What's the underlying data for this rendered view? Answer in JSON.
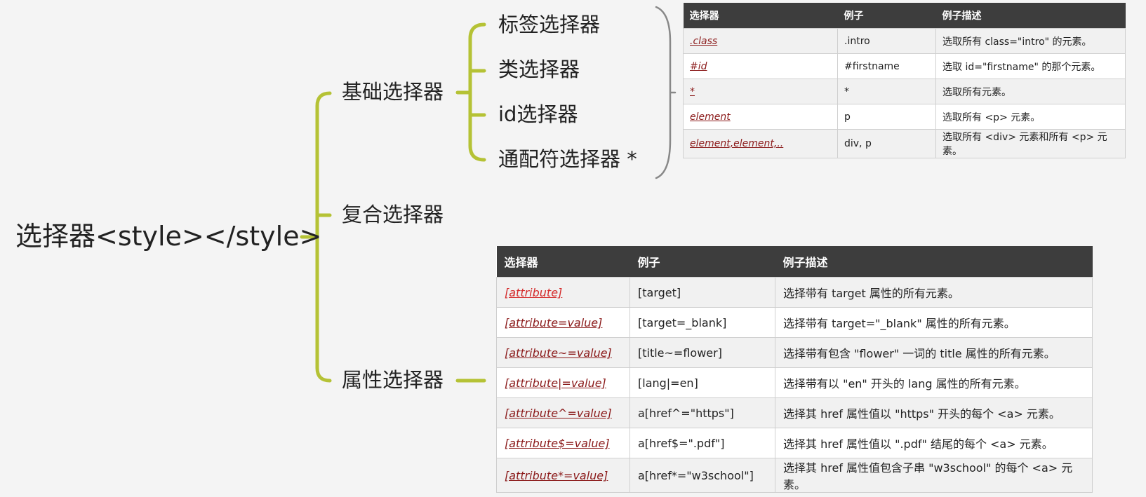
{
  "mindmap": {
    "root": "选择器<style></style>",
    "branches": [
      {
        "label": "基础选择器",
        "children": [
          "标签选择器",
          "类选择器",
          "id选择器",
          "通配符选择器 *"
        ]
      },
      {
        "label": "复合选择器"
      },
      {
        "label": "属性选择器"
      }
    ]
  },
  "colors": {
    "branch_line": "#b5c235",
    "bracket": "#888888",
    "table_header": "#3d3d3d",
    "selector_link": "#8b1a1a"
  },
  "basic_table": {
    "headers": [
      "选择器",
      "例子",
      "例子描述"
    ],
    "rows": [
      [
        ".class",
        ".intro",
        "选取所有 class=\"intro\" 的元素。"
      ],
      [
        "#id",
        "#firstname",
        "选取 id=\"firstname\" 的那个元素。"
      ],
      [
        "*",
        "*",
        "选取所有元素。"
      ],
      [
        "element",
        "p",
        "选取所有 <p> 元素。"
      ],
      [
        "element,element,..",
        "div, p",
        "选取所有 <div> 元素和所有 <p> 元素。"
      ]
    ]
  },
  "attribute_table": {
    "headers": [
      "选择器",
      "例子",
      "例子描述"
    ],
    "rows": [
      [
        "[attribute]",
        "[target]",
        "选择带有 target 属性的所有元素。"
      ],
      [
        "[attribute=value]",
        "[target=_blank]",
        "选择带有 target=\"_blank\" 属性的所有元素。"
      ],
      [
        "[attribute~=value]",
        "[title~=flower]",
        "选择带有包含 \"flower\" 一词的 title 属性的所有元素。"
      ],
      [
        "[attribute|=value]",
        "[lang|=en]",
        "选择带有以 \"en\" 开头的 lang 属性的所有元素。"
      ],
      [
        "[attribute^=value]",
        "a[href^=\"https\"]",
        "选择其 href 属性值以 \"https\" 开头的每个 <a> 元素。"
      ],
      [
        "[attribute$=value]",
        "a[href$=\".pdf\"]",
        "选择其 href 属性值以 \".pdf\" 结尾的每个 <a> 元素。"
      ],
      [
        "[attribute*=value]",
        "a[href*=\"w3school\"]",
        "选择其 href 属性值包含子串 \"w3school\" 的每个 <a> 元素。"
      ]
    ]
  }
}
